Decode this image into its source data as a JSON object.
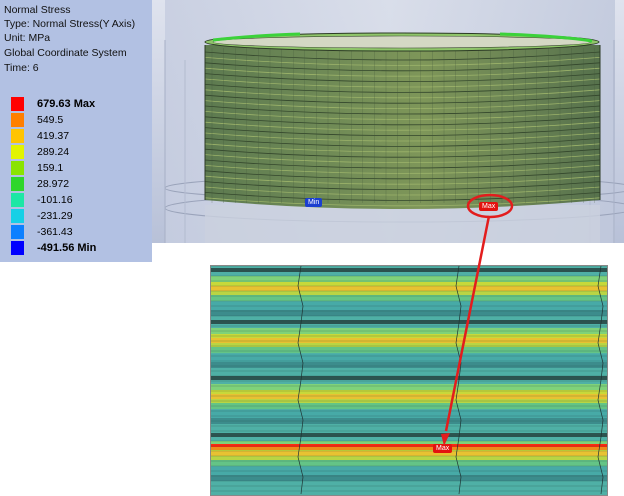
{
  "result_info": {
    "title": "Normal Stress",
    "type": "Type: Normal Stress(Y Axis)",
    "unit": "Unit: MPa",
    "coordinate_system": "Global Coordinate System",
    "time": "Time: 6"
  },
  "legend": [
    {
      "label": "679.63 Max",
      "color": "#ff0000",
      "bold": true
    },
    {
      "label": "549.5",
      "color": "#ff7f00",
      "bold": false
    },
    {
      "label": "419.37",
      "color": "#ffc400",
      "bold": false
    },
    {
      "label": "289.24",
      "color": "#e2f400",
      "bold": false
    },
    {
      "label": "159.1",
      "color": "#8ae400",
      "bold": false
    },
    {
      "label": "28.972",
      "color": "#2ed62b",
      "bold": false
    },
    {
      "label": "-101.16",
      "color": "#1de7a5",
      "bold": false
    },
    {
      "label": "-231.29",
      "color": "#16d0e6",
      "bold": false
    },
    {
      "label": "-361.43",
      "color": "#0d80ff",
      "bold": false
    },
    {
      "label": "-491.56 Min",
      "color": "#0000ff",
      "bold": true
    }
  ],
  "probes": {
    "min_label": "Min",
    "max_label": "Max",
    "detail_max_label": "Max"
  },
  "colors": {
    "max_probe": "#e3130f",
    "min_probe": "#1b3fd0",
    "annotation": "#e31d1d"
  }
}
